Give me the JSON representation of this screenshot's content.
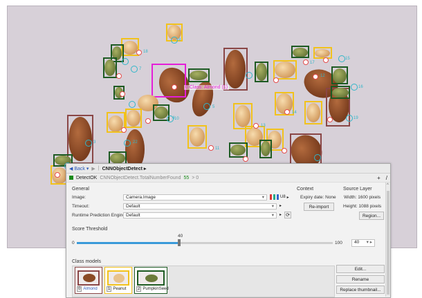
{
  "callout": "0 Class: Almond (1)",
  "marker_labels": [
    "8",
    "18",
    "7",
    "22",
    "3",
    "4",
    "5",
    "10",
    "11",
    "12",
    "13",
    "14",
    "15",
    "16",
    "17",
    "19"
  ],
  "toolbar": {
    "back": "Back",
    "forward": "▶",
    "tool_name": "CNNObjectDetect"
  },
  "status": {
    "flag": "DetectOK",
    "path": "CNNObjectDetect.TotalNumberFound",
    "count": "55",
    "arrow": "> 0",
    "plus": "+",
    "pen": "/"
  },
  "general": {
    "title": "General",
    "image_label": "Image:",
    "image_value": "Camera.Image",
    "image_suffix": "U8",
    "timeout_label": "Timeout:",
    "timeout_value": "Default",
    "engine_label": "Runtime Prediction Engine:",
    "engine_value": "Default"
  },
  "context": {
    "title": "Context",
    "expiry": "Expiry date: None",
    "reimport": "Re-import"
  },
  "source": {
    "title": "Source Layer",
    "width": "Width:  1600 pixels",
    "height": "Height:  1088 pixels",
    "region": "Region..."
  },
  "threshold": {
    "title": "Score Threshold",
    "min": "0",
    "max": "100",
    "value": "40",
    "current": "40"
  },
  "models": {
    "title": "Class models",
    "edit": "Edit...",
    "rename": "Rename",
    "replace": "Replace thumbnail...",
    "items": [
      {
        "num": "0",
        "name": "Almond"
      },
      {
        "num": "1",
        "name": "Peanut"
      },
      {
        "num": "2",
        "name": "PumpkinSeed"
      }
    ]
  },
  "colors": {
    "almond": "#8a4646",
    "peanut": "#f2c21b",
    "pumpkin": "#1d5a22",
    "selected": "#e41ed8",
    "marker": "#2fb6c9"
  }
}
